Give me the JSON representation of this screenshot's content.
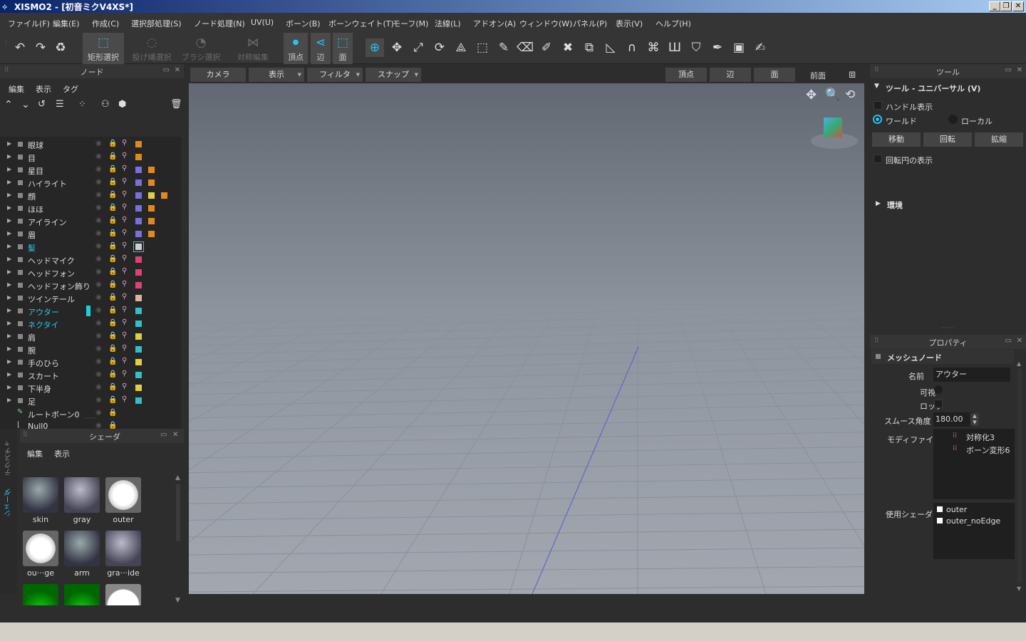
{
  "window": {
    "title": "XISMO2 - [初音ミクV4XS*]"
  },
  "menu": [
    "ファイル(F)",
    "編集(E)",
    "作成(C)",
    "選択部処理(S)",
    "ノード処理(N)",
    "UV(U)",
    "ボーン(B)",
    "ボーンウェイト(T)",
    "モーフ(M)",
    "法線(L)",
    "アドオン(A)",
    "ウィンドウ(W)",
    "パネル(P)",
    "表示(V)",
    "ヘルプ(H)"
  ],
  "toolbar": {
    "rect_select": "矩形選択",
    "lasso_select": "投げ縄選択",
    "brush_select": "ブラシ選択",
    "symmetry_edit": "対称編集",
    "vertex": "頂点",
    "edge": "辺",
    "face": "面"
  },
  "node_panel": {
    "title": "ノード",
    "menu": [
      "編集",
      "表示",
      "タグ"
    ],
    "nodes": [
      {
        "name": "眼球",
        "colors": [
          "#e08a1e"
        ]
      },
      {
        "name": "目",
        "colors": [
          "#e08a1e"
        ]
      },
      {
        "name": "星目",
        "colors": [
          "#7a6fe0",
          "#e08a1e"
        ]
      },
      {
        "name": "ハイライト",
        "colors": [
          "#7a6fe0",
          "#e08a1e"
        ]
      },
      {
        "name": "顔",
        "colors": [
          "#7a6fe0",
          "#e0d040",
          "#e08a1e"
        ]
      },
      {
        "name": "ほほ",
        "colors": [
          "#7a6fe0",
          "#e08a1e"
        ]
      },
      {
        "name": "アイライン",
        "colors": [
          "#7a6fe0",
          "#e08a1e"
        ]
      },
      {
        "name": "眉",
        "colors": [
          "#7a6fe0",
          "#e08a1e"
        ]
      },
      {
        "name": "髪",
        "colors": [
          "#cfcfcf"
        ],
        "highlight": true
      },
      {
        "name": "ヘッドマイク",
        "colors": [
          "#e0407a"
        ]
      },
      {
        "name": "ヘッドフォン",
        "colors": [
          "#e0407a"
        ]
      },
      {
        "name": "ヘッドフォン飾り",
        "colors": [
          "#e0407a"
        ]
      },
      {
        "name": "ツインテール",
        "colors": [
          "#e0b49a"
        ]
      },
      {
        "name": "アウター",
        "colors": [
          "#30c0c8"
        ],
        "highlight": true
      },
      {
        "name": "ネクタイ",
        "colors": [
          "#30c0c8"
        ],
        "highlight": true
      },
      {
        "name": "肩",
        "colors": [
          "#e0d040"
        ]
      },
      {
        "name": "腕",
        "colors": [
          "#30c0c8"
        ]
      },
      {
        "name": "手のひら",
        "colors": [
          "#e0d040"
        ]
      },
      {
        "name": "スカート",
        "colors": [
          "#30c0c8"
        ]
      },
      {
        "name": "下半身",
        "colors": [
          "#e0d040"
        ]
      },
      {
        "name": "足",
        "colors": [
          "#30c0c8"
        ]
      }
    ],
    "extra": [
      "ルートボーン0",
      "Null0"
    ]
  },
  "shader_panel": {
    "title": "シェーダ",
    "menu": [
      "編集",
      "表示"
    ],
    "side_tabs": [
      "テクスチャ",
      "シェーダ"
    ],
    "items": [
      "skin",
      "gray",
      "outer",
      "ou···ge",
      "arm",
      "gra···ide",
      "",
      ""
    ]
  },
  "viewport": {
    "camera": "カメラ",
    "display": "表示",
    "filter": "フィルタ",
    "snap": "スナップ",
    "vertex": "頂点",
    "edge": "辺",
    "face": "面",
    "view": "前面"
  },
  "tool_panel": {
    "title": "ツール",
    "section": "ツール - ユニバーサル (V)",
    "handle_show": "ハンドル表示",
    "world": "ワールド",
    "local": "ローカル",
    "move": "移動",
    "rotate": "回転",
    "scale": "拡縮",
    "rotation_circle": "回転円の表示",
    "environment": "環境"
  },
  "property_panel": {
    "title": "プロパティ",
    "section": "メッシュノード",
    "name_label": "名前",
    "name_value": "アウター",
    "visible_label": "可視",
    "lock_label": "ロック",
    "smooth_label": "スムース角度",
    "smooth_value": "180.00",
    "modifier_label": "モディファイア",
    "modifiers": [
      "対称化3",
      "ボーン変形6"
    ],
    "shader_label": "使用シェーダ",
    "shaders": [
      "outer",
      "outer_noEdge"
    ]
  }
}
